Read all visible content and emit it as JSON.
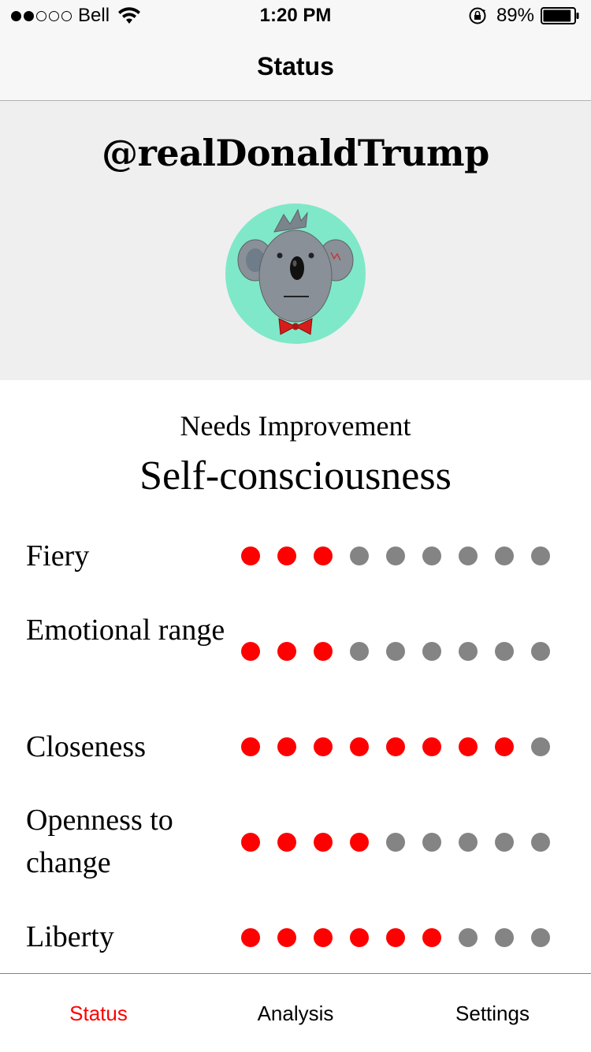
{
  "status_bar": {
    "carrier": "Bell",
    "time": "1:20 PM",
    "battery": "89%",
    "battery_level": 0.89,
    "signal_bars": 2,
    "signal_total": 5
  },
  "nav": {
    "title": "Status"
  },
  "profile": {
    "handle": "@realDonaldTrump",
    "avatar_icon": "koala-avatar-icon",
    "avatar_bg": "#7fe8c8"
  },
  "assessment": {
    "label": "Needs Improvement",
    "trait": "Self-consciousness"
  },
  "traits": [
    {
      "label": "Fiery",
      "score": 3,
      "max": 9
    },
    {
      "label": "Emotional range",
      "score": 3,
      "max": 9
    },
    {
      "label": "Closeness",
      "score": 8,
      "max": 9
    },
    {
      "label": "Openness to change",
      "score": 4,
      "max": 9
    },
    {
      "label": "Liberty",
      "score": 6,
      "max": 9
    }
  ],
  "tabs": [
    {
      "label": "Status",
      "active": true
    },
    {
      "label": "Analysis",
      "active": false
    },
    {
      "label": "Settings",
      "active": false
    }
  ],
  "colors": {
    "active_dot": "#ff0000",
    "inactive_dot": "#848484",
    "active_tab": "#ff0000",
    "tab_bar_border": "#38b83a"
  }
}
